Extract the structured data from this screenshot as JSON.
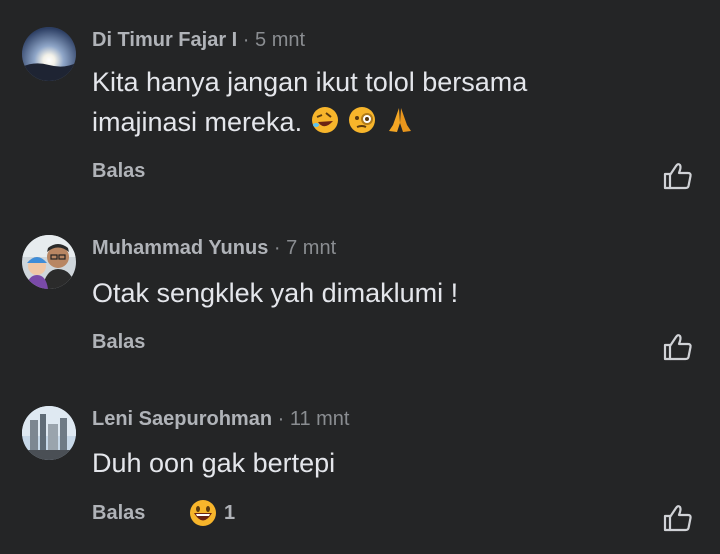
{
  "comments": [
    {
      "author": "Di Timur Fajar I",
      "separator": " · ",
      "time": "5 mnt",
      "text_line1": "Kita hanya jangan ikut tolol bersama",
      "text_line2": "imajinasi mereka.",
      "reply_label": "Balas"
    },
    {
      "author": "Muhammad Yunus",
      "separator": " · ",
      "time": "7 mnt",
      "text_line1": "Otak sengklek yah dimaklumi !",
      "reply_label": "Balas"
    },
    {
      "author": "Leni Saepurohman",
      "separator": " · ",
      "time": "11 mnt",
      "text_line1": "Duh oon gak bertepi",
      "reply_label": "Balas",
      "reaction_count": "1"
    }
  ],
  "icons": {
    "like": "thumbs-up-outline-icon",
    "emoji_1": "rolling-laughing-emoji",
    "emoji_2": "monocle-face-emoji",
    "emoji_3": "folded-hands-emoji",
    "reaction": "grinning-face-emoji"
  },
  "colors": {
    "background": "#242526",
    "name": "#b0b3b8",
    "text": "#e4e6eb"
  }
}
